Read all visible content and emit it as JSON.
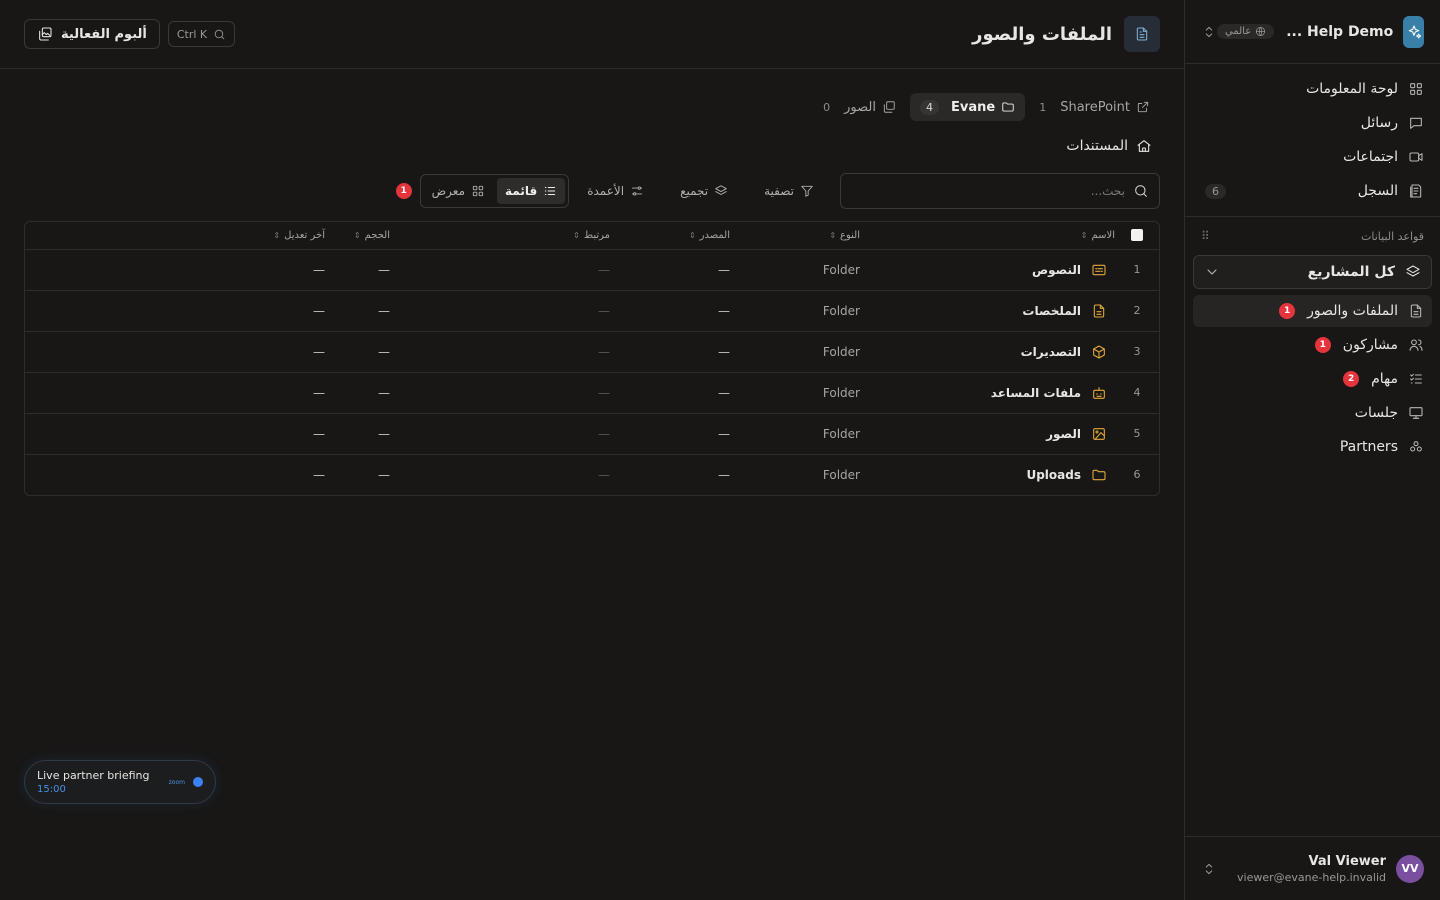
{
  "workspace": {
    "name": "Help Demo ...",
    "scope_badge": "عالمي"
  },
  "nav": {
    "items": [
      {
        "label": "لوحة المعلومات",
        "icon": "grid-icon",
        "count": ""
      },
      {
        "label": "رسائل",
        "icon": "message-icon",
        "count": ""
      },
      {
        "label": "اجتماعات",
        "icon": "video-icon",
        "count": ""
      },
      {
        "label": "السجل",
        "icon": "log-icon",
        "count": "6"
      }
    ]
  },
  "databases": {
    "section_label": "قواعد البيانات",
    "project_select": "كل المشاريع",
    "items": [
      {
        "label": "الملفات والصور",
        "badge": "1",
        "active": true
      },
      {
        "label": "مشاركون",
        "badge": "1"
      },
      {
        "label": "مهام",
        "badge": "2"
      },
      {
        "label": "جلسات",
        "badge": ""
      },
      {
        "label": "Partners",
        "badge": ""
      }
    ]
  },
  "user": {
    "initials": "VV",
    "name": "Val Viewer",
    "email": "viewer@evane-help.invalid"
  },
  "header": {
    "title": "الملفات والصور",
    "album_button": "ألبوم الفعالية",
    "search_shortcut": "Ctrl K"
  },
  "sources": {
    "tabs": [
      {
        "label": "SharePoint",
        "count": "1"
      },
      {
        "label": "Evane",
        "count": "4",
        "active": true
      },
      {
        "label": "الصور",
        "count": "0"
      }
    ]
  },
  "breadcrumb": {
    "label": "المستندات"
  },
  "toolbar": {
    "search_placeholder": "بحث...",
    "filter": "تصفية",
    "group": "تجميع",
    "columns": "الأعمدة",
    "view_list": "قائمة",
    "view_gallery": "معرض",
    "badge": "1"
  },
  "table": {
    "headers": {
      "name": "الاسم",
      "type": "النوع",
      "source": "المصدر",
      "linked": "مرتبط",
      "size": "الحجم",
      "modified": "آخر تعديل"
    },
    "rows": [
      {
        "num": "1",
        "name": "النصوص",
        "icon": "text-box-icon",
        "type": "Folder",
        "source": "—",
        "linked": "—",
        "size": "—",
        "modified": "—"
      },
      {
        "num": "2",
        "name": "الملخصات",
        "icon": "document-icon",
        "type": "Folder",
        "source": "—",
        "linked": "—",
        "size": "—",
        "modified": "—"
      },
      {
        "num": "3",
        "name": "التصديرات",
        "icon": "package-icon",
        "type": "Folder",
        "source": "—",
        "linked": "—",
        "size": "—",
        "modified": "—"
      },
      {
        "num": "4",
        "name": "ملفات المساعد",
        "icon": "bot-icon",
        "type": "Folder",
        "source": "—",
        "linked": "—",
        "size": "—",
        "modified": "—"
      },
      {
        "num": "5",
        "name": "الصور",
        "icon": "image-icon",
        "type": "Folder",
        "source": "—",
        "linked": "—",
        "size": "—",
        "modified": "—"
      },
      {
        "num": "6",
        "name": "Uploads",
        "icon": "folder-icon",
        "type": "Folder",
        "source": "—",
        "linked": "—",
        "size": "—",
        "modified": "—"
      }
    ]
  },
  "toast": {
    "title": "Live partner briefing",
    "time": "15:00",
    "provider": "zoom"
  },
  "colors": {
    "accent": "#3a7fa8",
    "folder_icon": "#e3a83a",
    "badge_red": "#e5343c",
    "live_blue": "#3b82f6"
  }
}
